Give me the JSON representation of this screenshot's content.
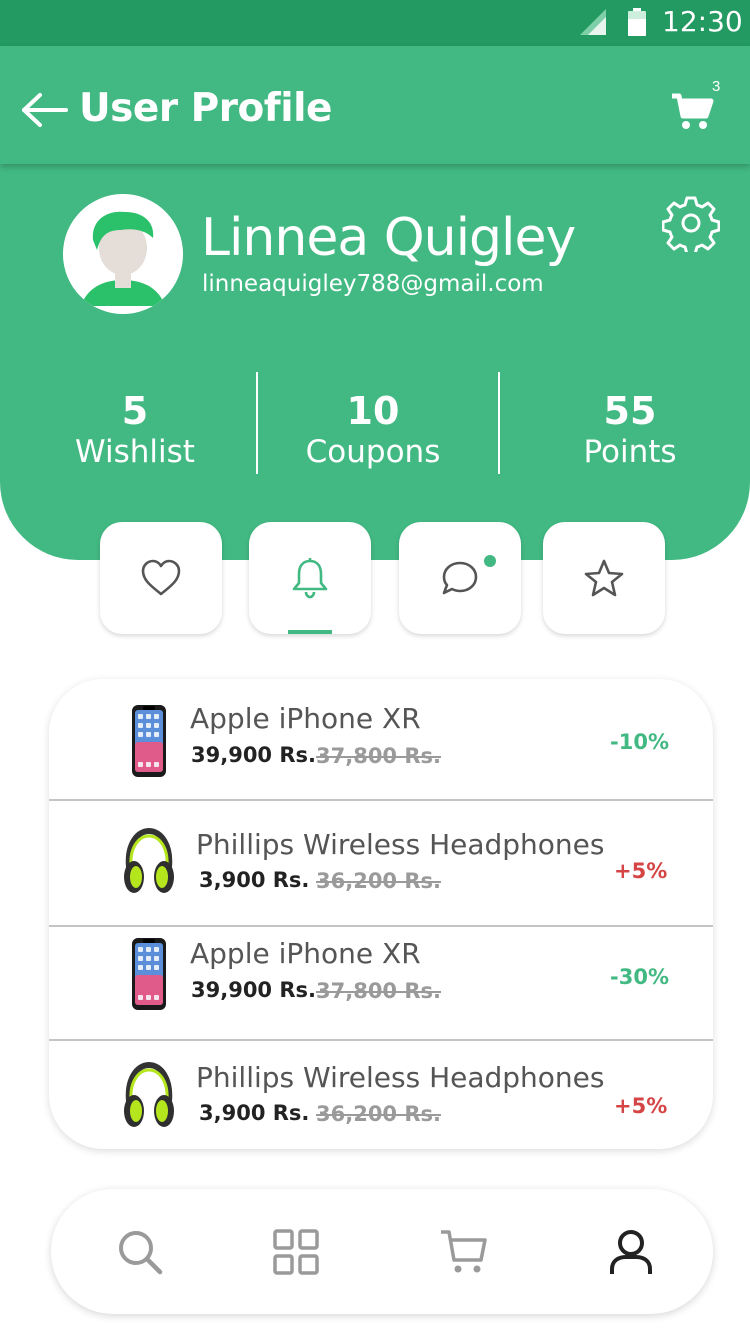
{
  "status_bar": {
    "time": "12:30"
  },
  "app_bar": {
    "title": "User Profile",
    "cart_count": "3"
  },
  "profile": {
    "name": "Linnea Quigley",
    "email": "linneaquigley788@gmail.com"
  },
  "stats": [
    {
      "value": "5",
      "label": "Wishlist"
    },
    {
      "value": "10",
      "label": "Coupons"
    },
    {
      "value": "55",
      "label": "Points"
    }
  ],
  "tabs": [
    {
      "icon": "heart-icon"
    },
    {
      "icon": "bell-icon",
      "active": true
    },
    {
      "icon": "chat-icon",
      "has_dot": true
    },
    {
      "icon": "star-icon"
    }
  ],
  "products": [
    {
      "name": "Apple iPhone XR",
      "price": "39,900 Rs.",
      "old_price": "37,800 Rs.",
      "discount": "-10%",
      "icon": "phone-icon"
    },
    {
      "name": "Phillips Wireless Headphones",
      "price": "3,900 Rs.",
      "old_price": "36,200 Rs.",
      "discount": "+5%",
      "icon": "headphones-icon"
    },
    {
      "name": "Apple iPhone XR",
      "price": "39,900 Rs.",
      "old_price": "37,800 Rs.",
      "discount": "-30%",
      "icon": "phone-icon"
    },
    {
      "name": "Phillips Wireless Headphones",
      "price": "3,900 Rs.",
      "old_price": "36,200 Rs.",
      "discount": "+5%",
      "icon": "headphones-icon"
    }
  ],
  "bottom_nav": [
    {
      "icon": "search-icon"
    },
    {
      "icon": "grid-icon"
    },
    {
      "icon": "cart-icon"
    },
    {
      "icon": "user-icon",
      "active": true
    }
  ],
  "colors": {
    "primary": "#42b983",
    "status_bar": "#239a62",
    "discount_negative": "#42b983",
    "discount_positive": "#d64545"
  }
}
